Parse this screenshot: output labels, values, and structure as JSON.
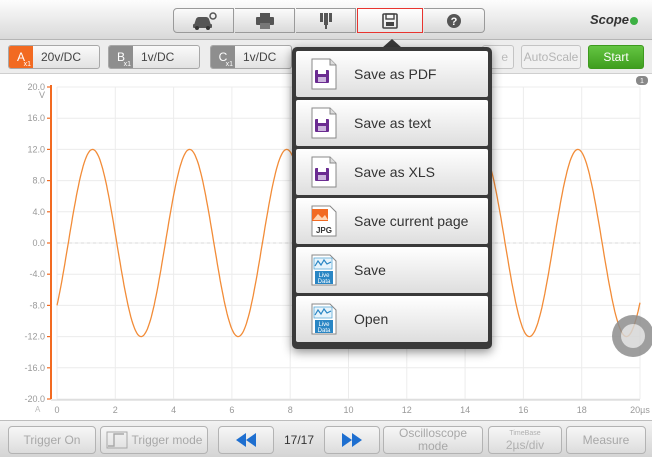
{
  "brand": {
    "name": "Scope"
  },
  "toolbar": {
    "icons": [
      "car-settings-icon",
      "print-icon",
      "probe-icon",
      "save-icon",
      "help-icon"
    ],
    "active": "save-icon",
    "accent": "#e8342f"
  },
  "channels": [
    {
      "letter": "A",
      "sub": "x1",
      "value": "20v/DC",
      "color": "#f26a21",
      "active": true
    },
    {
      "letter": "B",
      "sub": "x1",
      "value": "1v/DC",
      "color": "#8e8e8e",
      "active": false
    },
    {
      "letter": "C",
      "sub": "x1",
      "value": "1v/DC",
      "color": "#8e8e8e",
      "active": false
    }
  ],
  "controls": {
    "hidden_partial": "e",
    "autoscale": "AutoScale",
    "start": "Start",
    "start_color": "#4caf2a"
  },
  "menu": {
    "items": [
      {
        "label": "Save as PDF",
        "icon": "pdf-save-icon"
      },
      {
        "label": "Save as text",
        "icon": "text-save-icon"
      },
      {
        "label": "Save as XLS",
        "icon": "xls-save-icon"
      },
      {
        "label": "Save current page",
        "icon": "jpg-icon"
      },
      {
        "label": "Save",
        "icon": "live-data-save-icon"
      },
      {
        "label": "Open",
        "icon": "live-data-open-icon"
      }
    ]
  },
  "chart_data": {
    "type": "line",
    "y_ticks": [
      "20.0",
      "16.0",
      "12.0",
      "8.0",
      "4.0",
      "0.0",
      "-4.0",
      "-8.0",
      "-12.0",
      "-16.0",
      "-20.0"
    ],
    "y_unit": "V",
    "x_ticks": [
      "0",
      "2",
      "4",
      "6",
      "8",
      "10",
      "12",
      "14",
      "16",
      "18",
      "20µs"
    ],
    "ylim": [
      -20,
      20
    ],
    "xlim": [
      0,
      20
    ],
    "series": [
      {
        "color": "#f28c38",
        "amplitude": 12,
        "period": 3.33,
        "phase_start_value": -8
      }
    ],
    "grid": true,
    "marker_a": "A",
    "marker_1": "1"
  },
  "bottom": {
    "trigger_on": "Trigger On",
    "trigger_mode": "Trigger mode",
    "page": "17/17",
    "mode_line1": "Oscilloscope",
    "mode_line2": "mode",
    "timebase_label": "TimeBase",
    "timebase_value": "2µs/div",
    "measure": "Measure",
    "nav_color": "#1e6fd0"
  }
}
